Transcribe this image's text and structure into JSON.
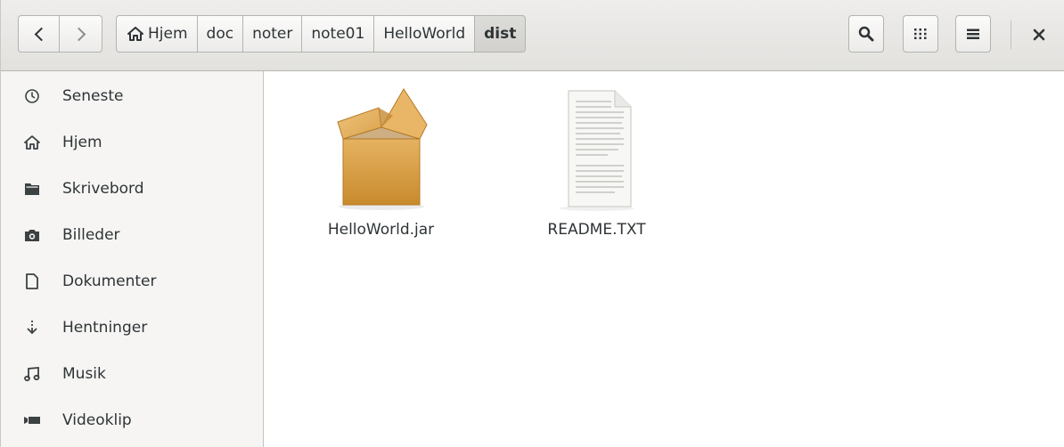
{
  "toolbar": {
    "back_icon": "chevron-left-icon",
    "forward_icon": "chevron-right-icon",
    "search_icon": "search-icon",
    "view_icon": "grid-view-icon",
    "menu_icon": "hamburger-menu-icon",
    "close_icon": "close-icon"
  },
  "breadcrumbs": [
    {
      "label": "Hjem",
      "icon": "home-icon"
    },
    {
      "label": "doc"
    },
    {
      "label": "noter"
    },
    {
      "label": "note01"
    },
    {
      "label": "HelloWorld"
    },
    {
      "label": "dist",
      "active": true
    }
  ],
  "sidebar": {
    "items": [
      {
        "label": "Seneste",
        "icon": "clock-icon"
      },
      {
        "label": "Hjem",
        "icon": "home-icon"
      },
      {
        "label": "Skrivebord",
        "icon": "folder-icon"
      },
      {
        "label": "Billeder",
        "icon": "camera-icon"
      },
      {
        "label": "Dokumenter",
        "icon": "document-icon"
      },
      {
        "label": "Hentninger",
        "icon": "download-icon"
      },
      {
        "label": "Musik",
        "icon": "music-icon"
      },
      {
        "label": "Videoklip",
        "icon": "video-icon"
      }
    ]
  },
  "files": [
    {
      "name": "HelloWorld.jar",
      "icon": "package-icon"
    },
    {
      "name": "README.TXT",
      "icon": "text-file-icon"
    }
  ],
  "colors": {
    "header_bg": "#e6e5e2",
    "sidebar_bg": "#f6f5f4",
    "text": "#2e3436",
    "package": "#d49a3a"
  }
}
